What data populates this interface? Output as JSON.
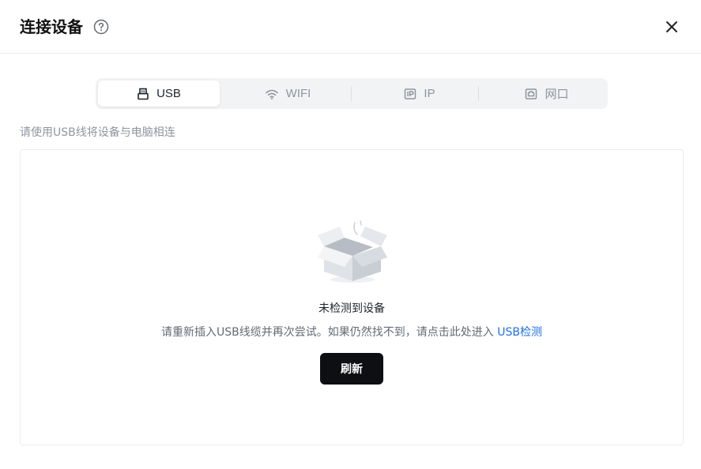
{
  "dialog": {
    "title": "连接设备",
    "help_icon": "question-circle-icon",
    "close_icon": "close-icon"
  },
  "tabs": [
    {
      "label": "USB",
      "icon": "usb-icon",
      "active": true
    },
    {
      "label": "WIFI",
      "icon": "wifi-icon",
      "active": false
    },
    {
      "label": "IP",
      "icon": "ip-icon",
      "active": false
    },
    {
      "label": "网口",
      "icon": "ethernet-port-icon",
      "active": false
    }
  ],
  "hint": "请使用USB线将设备与电脑相连",
  "empty_state": {
    "illustration": "empty-box-icon",
    "title": "未检测到设备",
    "description": "请重新插入USB线缆并再次尝试。如果仍然找不到，请点击此处进入",
    "link_label": "USB检测",
    "button_label": "刷新"
  },
  "colors": {
    "link": "#1f6fe5",
    "primary_button": "#0d0f12",
    "tab_bar_bg": "#f2f3f5"
  }
}
